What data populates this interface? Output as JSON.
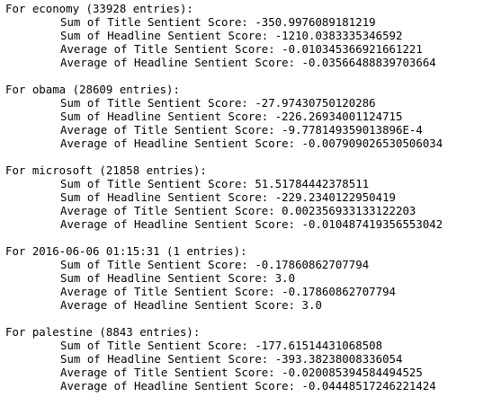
{
  "output": {
    "groups": [
      {
        "header": "For economy (33928 entries):",
        "lines": [
          "Sum of Title Sentient Score: -350.9976089181219",
          "Sum of Headline Sentient Score: -1210.0383335346592",
          "Average of Title Sentient Score: -0.010345366921661221",
          "Average of Headline Sentient Score: -0.03566488839703664"
        ]
      },
      {
        "header": "For obama (28609 entries):",
        "lines": [
          "Sum of Title Sentient Score: -27.97430750120286",
          "Sum of Headline Sentient Score: -226.26934001124715",
          "Average of Title Sentient Score: -9.778149359013896E-4",
          "Average of Headline Sentient Score: -0.007909026530506034"
        ]
      },
      {
        "header": "For microsoft (21858 entries):",
        "lines": [
          "Sum of Title Sentient Score: 51.51784442378511",
          "Sum of Headline Sentient Score: -229.2340122950419",
          "Average of Title Sentient Score: 0.002356933133122203",
          "Average of Headline Sentient Score: -0.010487419356553042"
        ]
      },
      {
        "header": "For 2016-06-06 01:15:31 (1 entries):",
        "lines": [
          "Sum of Title Sentient Score: -0.17860862707794",
          "Sum of Headline Sentient Score: 3.0",
          "Average of Title Sentient Score: -0.17860862707794",
          "Average of Headline Sentient Score: 3.0"
        ]
      },
      {
        "header": "For palestine (8843 entries):",
        "lines": [
          "Sum of Title Sentient Score: -177.61514431068508",
          "Sum of Headline Sentient Score: -393.38238008336054",
          "Average of Title Sentient Score: -0.020085394584494525",
          "Average of Headline Sentient Score: -0.04448517246221424"
        ]
      }
    ]
  }
}
